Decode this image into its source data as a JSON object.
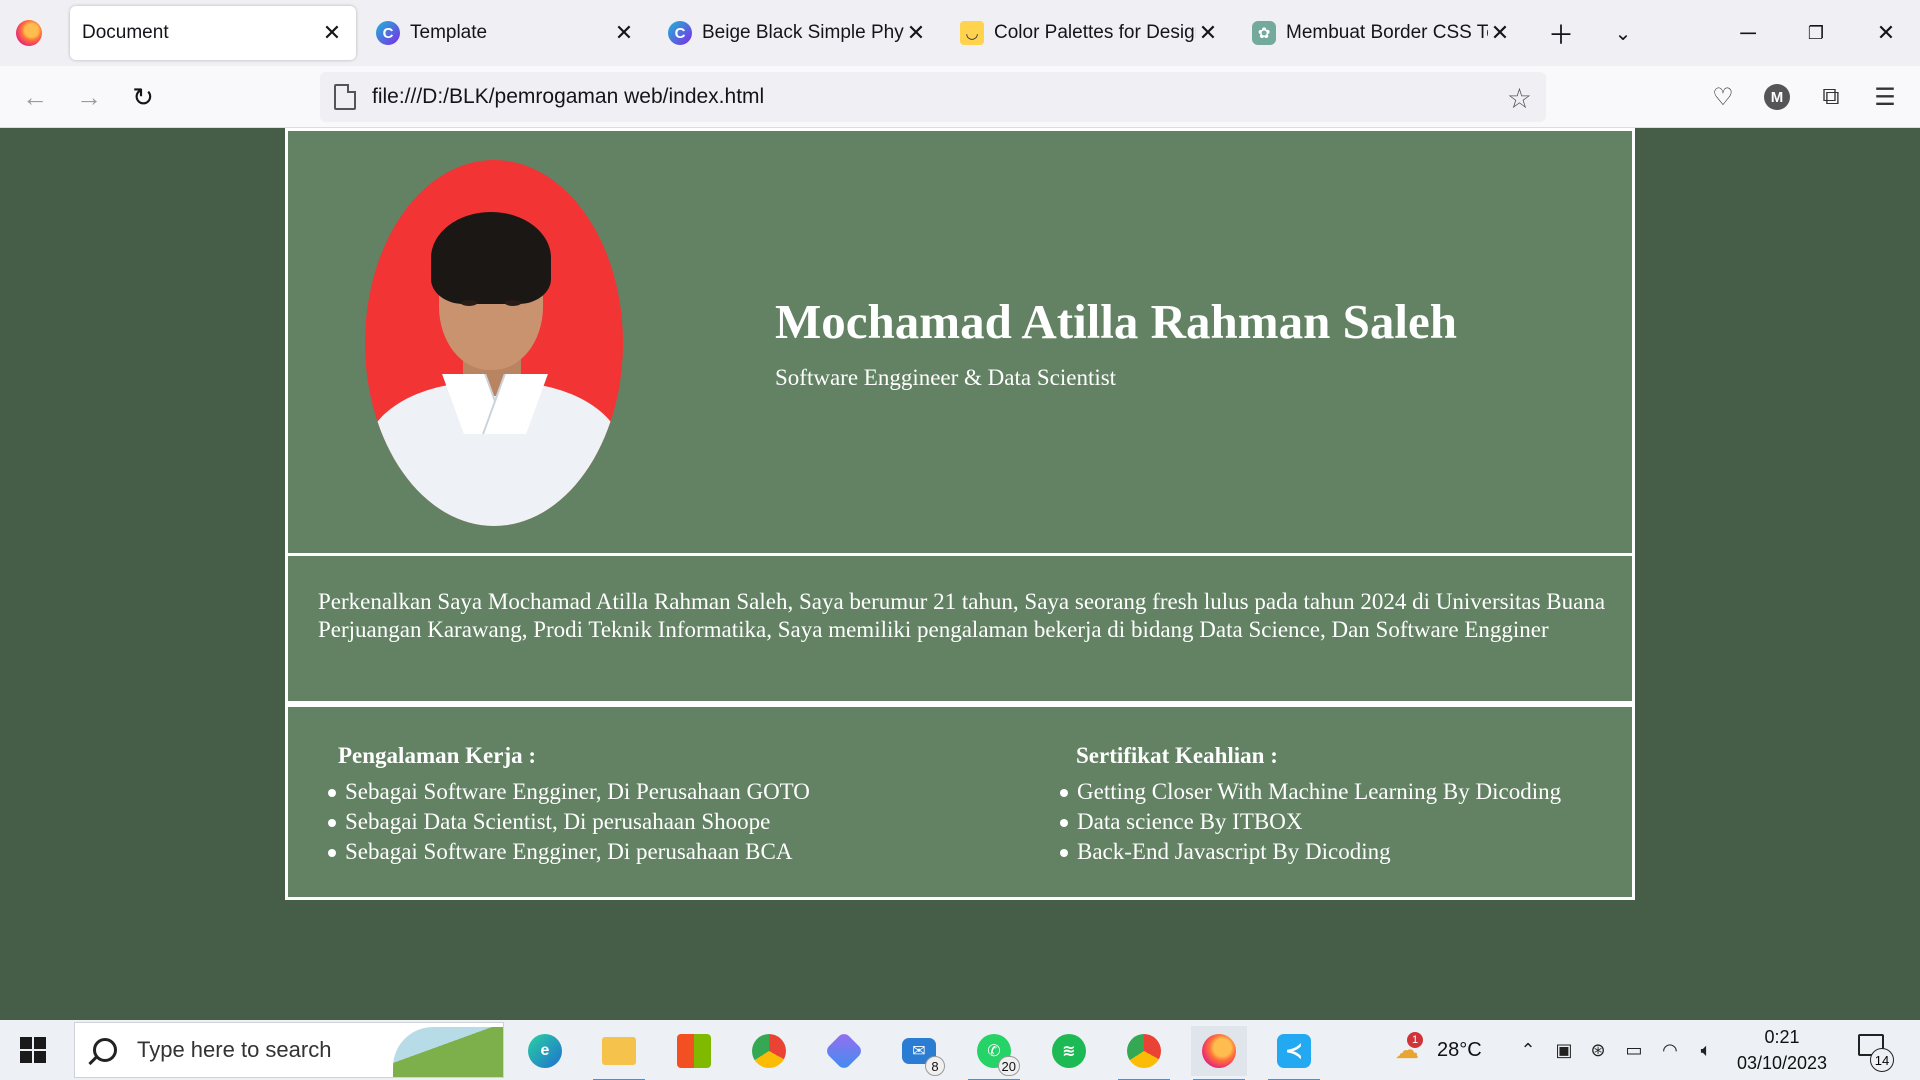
{
  "browser": {
    "tabs": [
      {
        "title": "Document",
        "active": true
      },
      {
        "title": "Template",
        "active": false
      },
      {
        "title": "Beige Black Simple Physici",
        "active": false
      },
      {
        "title": "Color Palettes for Designe",
        "active": false
      },
      {
        "title": "Membuat Border CSS Tena",
        "active": false
      }
    ],
    "url": "file:///D:/BLK/pemrogaman web/index.html",
    "account_initial": "M"
  },
  "profile": {
    "name": "Mochamad Atilla Rahman Saleh",
    "role": "Software Enggineer & Data Scientist",
    "stray_char": ">",
    "intro": "Perkenalkan Saya Mochamad Atilla Rahman Saleh, Saya berumur 21 tahun, Saya seorang fresh lulus pada tahun 2024 di Universitas Buana Perjuangan Karawang, Prodi Teknik Informatika, Saya memiliki pengalaman bekerja di bidang Data Science, Dan Software Engginer",
    "experience": {
      "heading": "Pengalaman Kerja :",
      "items": [
        "Sebagai Software Engginer, Di Perusahaan GOTO",
        "Sebagai Data Scientist, Di perusahaan Shoope",
        "Sebagai Software Engginer, Di perusahaan BCA"
      ]
    },
    "certificates": {
      "heading": "Sertifikat Keahlian :",
      "items": [
        "Getting Closer With Machine Learning By Dicoding",
        "Data science By ITBOX",
        "Back-End Javascript By Dicoding"
      ]
    }
  },
  "taskbar": {
    "search_placeholder": "Type here to search",
    "mail_badge": "8",
    "whatsapp_badge": "20",
    "weather_alert": "1",
    "temperature": "28°C",
    "time": "0:21",
    "date": "03/10/2023",
    "notification_count": "14"
  },
  "colors": {
    "page_bg": "#465e48",
    "card_bg": "#628263",
    "border": "#ffffff"
  }
}
